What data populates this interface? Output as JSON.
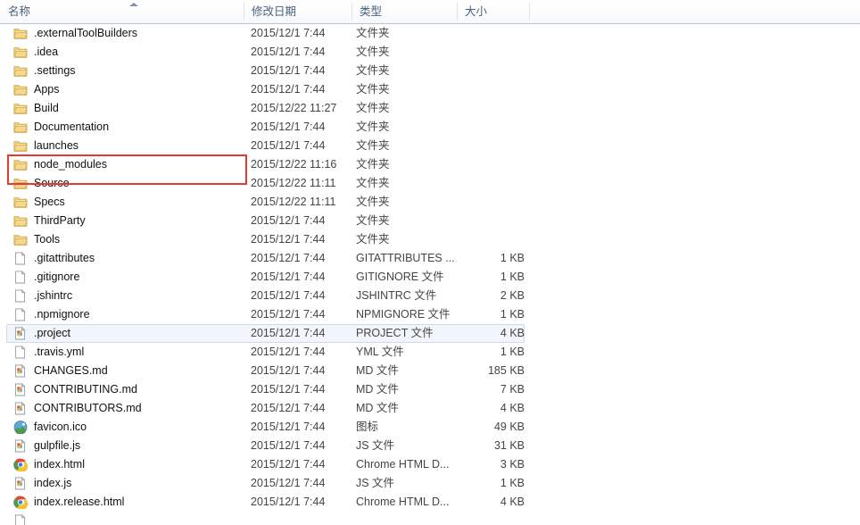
{
  "window": {
    "view": "details-list"
  },
  "columns": [
    {
      "key": "name",
      "label": "名称",
      "sorted": "asc"
    },
    {
      "key": "date",
      "label": "修改日期",
      "sorted": ""
    },
    {
      "key": "type",
      "label": "类型",
      "sorted": ""
    },
    {
      "key": "size",
      "label": "大小",
      "sorted": ""
    }
  ],
  "annotation": {
    "color": "#e8392e",
    "target_row": "node_modules"
  },
  "selection": {
    "selected_row": ".project",
    "highlight_color": "#f2f6fc",
    "border_color": "#cdd9ec"
  },
  "rows": [
    {
      "name": ".externalToolBuilders",
      "date": "2015/12/1 7:44",
      "type": "文件夹",
      "size": "",
      "icon": "folder-icon",
      "selected": false
    },
    {
      "name": ".idea",
      "date": "2015/12/1 7:44",
      "type": "文件夹",
      "size": "",
      "icon": "folder-icon",
      "selected": false
    },
    {
      "name": ".settings",
      "date": "2015/12/1 7:44",
      "type": "文件夹",
      "size": "",
      "icon": "folder-icon",
      "selected": false
    },
    {
      "name": "Apps",
      "date": "2015/12/1 7:44",
      "type": "文件夹",
      "size": "",
      "icon": "folder-icon",
      "selected": false
    },
    {
      "name": "Build",
      "date": "2015/12/22 11:27",
      "type": "文件夹",
      "size": "",
      "icon": "folder-icon",
      "selected": false
    },
    {
      "name": "Documentation",
      "date": "2015/12/1 7:44",
      "type": "文件夹",
      "size": "",
      "icon": "folder-icon",
      "selected": false
    },
    {
      "name": "launches",
      "date": "2015/12/1 7:44",
      "type": "文件夹",
      "size": "",
      "icon": "folder-icon",
      "selected": false
    },
    {
      "name": "node_modules",
      "date": "2015/12/22 11:16",
      "type": "文件夹",
      "size": "",
      "icon": "folder-icon",
      "selected": false
    },
    {
      "name": "Source",
      "date": "2015/12/22 11:11",
      "type": "文件夹",
      "size": "",
      "icon": "folder-icon",
      "selected": false
    },
    {
      "name": "Specs",
      "date": "2015/12/22 11:11",
      "type": "文件夹",
      "size": "",
      "icon": "folder-icon",
      "selected": false
    },
    {
      "name": "ThirdParty",
      "date": "2015/12/1 7:44",
      "type": "文件夹",
      "size": "",
      "icon": "folder-icon",
      "selected": false
    },
    {
      "name": "Tools",
      "date": "2015/12/1 7:44",
      "type": "文件夹",
      "size": "",
      "icon": "folder-icon",
      "selected": false
    },
    {
      "name": ".gitattributes",
      "date": "2015/12/1 7:44",
      "type": "GITATTRIBUTES ...",
      "size": "1 KB",
      "icon": "blank-file-icon",
      "selected": false
    },
    {
      "name": ".gitignore",
      "date": "2015/12/1 7:44",
      "type": "GITIGNORE 文件",
      "size": "1 KB",
      "icon": "blank-file-icon",
      "selected": false
    },
    {
      "name": ".jshintrc",
      "date": "2015/12/1 7:44",
      "type": "JSHINTRC 文件",
      "size": "2 KB",
      "icon": "blank-file-icon",
      "selected": false
    },
    {
      "name": ".npmignore",
      "date": "2015/12/1 7:44",
      "type": "NPMIGNORE 文件",
      "size": "1 KB",
      "icon": "blank-file-icon",
      "selected": false
    },
    {
      "name": ".project",
      "date": "2015/12/1 7:44",
      "type": "PROJECT 文件",
      "size": "4 KB",
      "icon": "text-editor-icon",
      "selected": true
    },
    {
      "name": ".travis.yml",
      "date": "2015/12/1 7:44",
      "type": "YML 文件",
      "size": "1 KB",
      "icon": "blank-file-icon",
      "selected": false
    },
    {
      "name": "CHANGES.md",
      "date": "2015/12/1 7:44",
      "type": "MD 文件",
      "size": "185 KB",
      "icon": "text-editor-icon",
      "selected": false
    },
    {
      "name": "CONTRIBUTING.md",
      "date": "2015/12/1 7:44",
      "type": "MD 文件",
      "size": "7 KB",
      "icon": "text-editor-icon",
      "selected": false
    },
    {
      "name": "CONTRIBUTORS.md",
      "date": "2015/12/1 7:44",
      "type": "MD 文件",
      "size": "4 KB",
      "icon": "text-editor-icon",
      "selected": false
    },
    {
      "name": "favicon.ico",
      "date": "2015/12/1 7:44",
      "type": "图标",
      "size": "49 KB",
      "icon": "image-icon",
      "selected": false
    },
    {
      "name": "gulpfile.js",
      "date": "2015/12/1 7:44",
      "type": "JS 文件",
      "size": "31 KB",
      "icon": "text-editor-icon",
      "selected": false
    },
    {
      "name": "index.html",
      "date": "2015/12/1 7:44",
      "type": "Chrome HTML D...",
      "size": "3 KB",
      "icon": "chrome-icon",
      "selected": false
    },
    {
      "name": "index.js",
      "date": "2015/12/1 7:44",
      "type": "JS 文件",
      "size": "1 KB",
      "icon": "text-editor-icon",
      "selected": false
    },
    {
      "name": "index.release.html",
      "date": "2015/12/1 7:44",
      "type": "Chrome HTML D...",
      "size": "4 KB",
      "icon": "chrome-icon",
      "selected": false
    },
    {
      "name": "",
      "date": "",
      "type": "",
      "size": "",
      "icon": "blank-file-icon",
      "selected": false
    }
  ]
}
